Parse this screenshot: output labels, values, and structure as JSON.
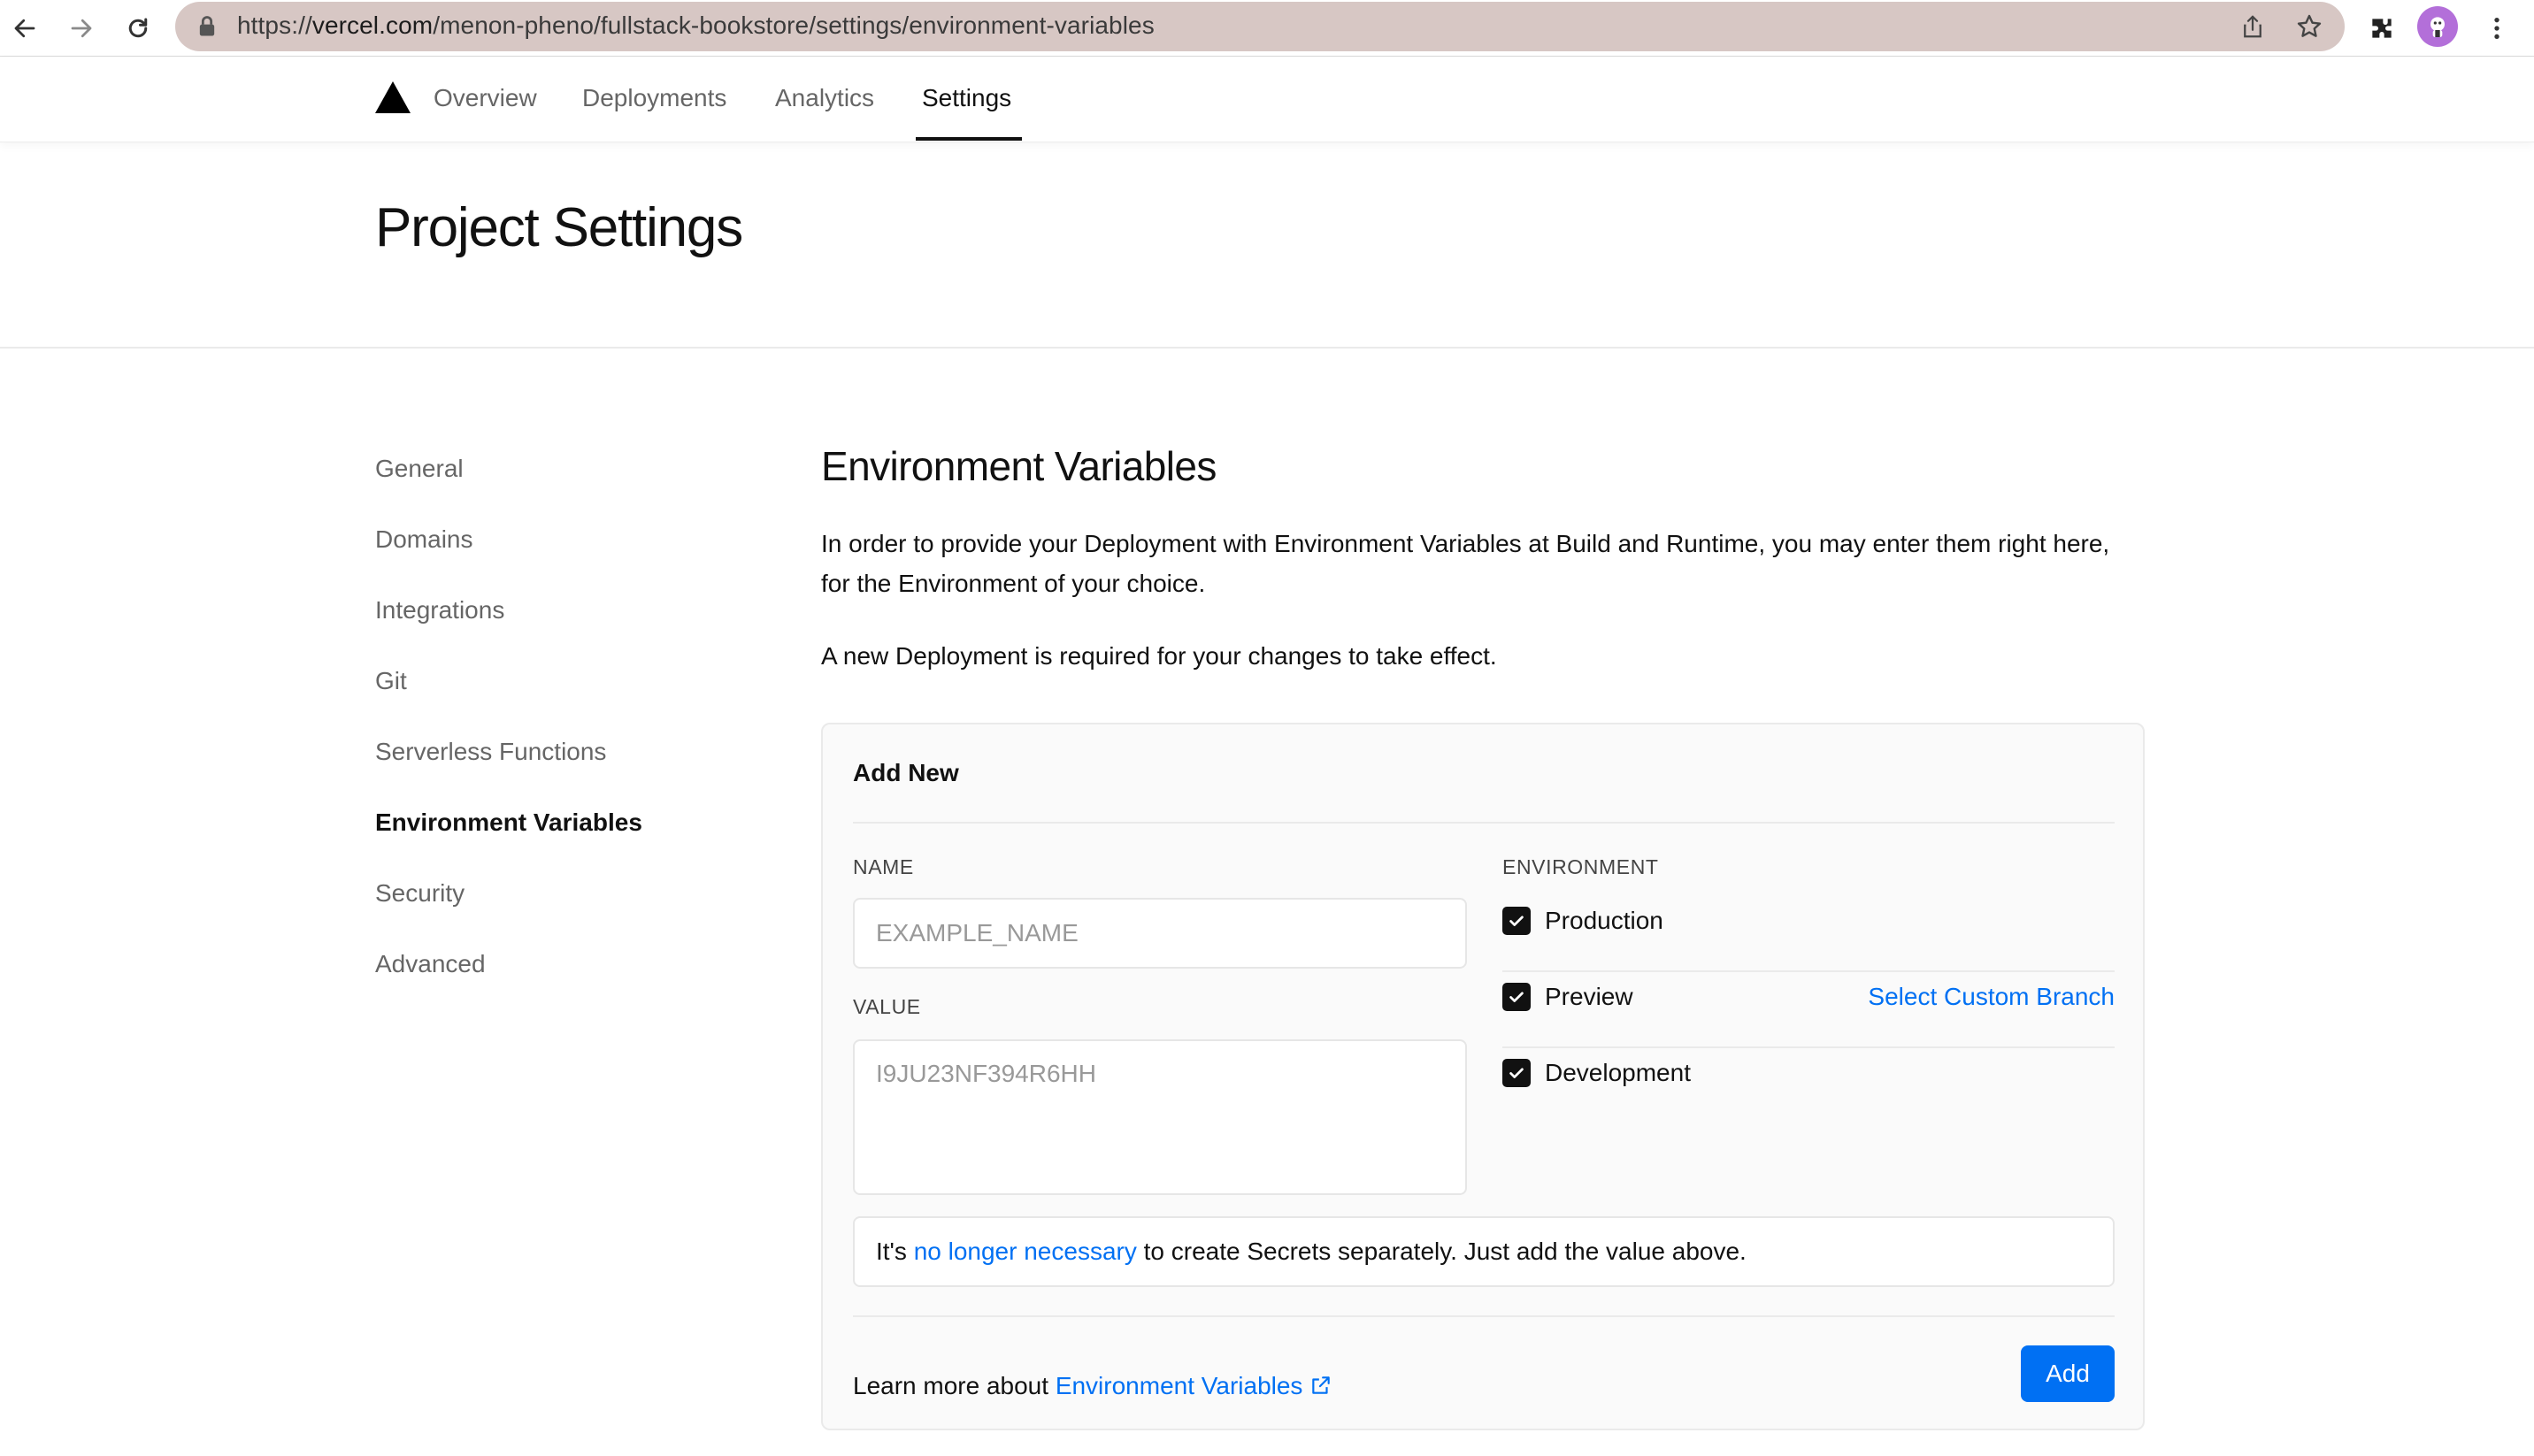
{
  "browser": {
    "url_prefix": "https://",
    "url_host": "vercel.com",
    "url_path": "/menon-pheno/fullstack-bookstore/settings/environment-variables"
  },
  "nav": {
    "tabs": [
      {
        "label": "Overview"
      },
      {
        "label": "Deployments"
      },
      {
        "label": "Analytics"
      },
      {
        "label": "Settings",
        "active": true
      }
    ]
  },
  "header": {
    "title": "Project Settings"
  },
  "sidebar": {
    "items": [
      {
        "label": "General"
      },
      {
        "label": "Domains"
      },
      {
        "label": "Integrations"
      },
      {
        "label": "Git"
      },
      {
        "label": "Serverless Functions"
      },
      {
        "label": "Environment Variables",
        "active": true
      },
      {
        "label": "Security"
      },
      {
        "label": "Advanced"
      }
    ]
  },
  "main": {
    "title": "Environment Variables",
    "description": "In order to provide your Deployment with Environment Variables at Build and Runtime, you may enter them right here, for the Environment of your choice.",
    "notice": "A new Deployment is required for your changes to take effect."
  },
  "form": {
    "title": "Add New",
    "name_label": "NAME",
    "name_placeholder": "EXAMPLE_NAME",
    "value_label": "VALUE",
    "value_placeholder": "I9JU23NF394R6HH",
    "environment_label": "ENVIRONMENT",
    "environments": [
      {
        "label": "Production",
        "checked": true
      },
      {
        "label": "Preview",
        "checked": true
      },
      {
        "label": "Development",
        "checked": true
      }
    ],
    "custom_branch_link": "Select Custom Branch",
    "note_prefix": "It's ",
    "note_link": "no longer necessary",
    "note_suffix": " to create Secrets separately. Just add the value above.",
    "learn_prefix": "Learn more about ",
    "learn_link": "Environment Variables",
    "add_button": "Add"
  },
  "colors": {
    "accent": "#0070f3",
    "url_bar": "#d7c7c4",
    "avatar": "#b36fd9"
  }
}
